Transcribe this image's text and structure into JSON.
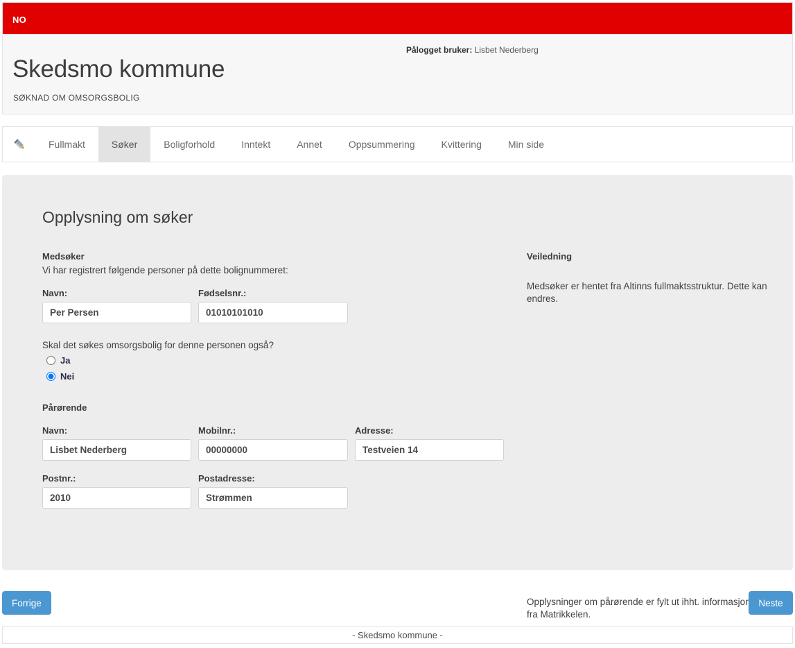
{
  "language_bar": {
    "language": "NO"
  },
  "header": {
    "logged_in_label": "Pålogget bruker:",
    "logged_in_user": "Lisbet Nederberg",
    "title": "Skedsmo kommune",
    "subtitle": "SØKNAD OM OMSORGSBOLIG"
  },
  "tabs": {
    "pencil_icon": "pencil-icon",
    "items": [
      {
        "label": "Fullmakt",
        "active": false
      },
      {
        "label": "Søker",
        "active": true
      },
      {
        "label": "Boligforhold",
        "active": false
      },
      {
        "label": "Inntekt",
        "active": false
      },
      {
        "label": "Annet",
        "active": false
      },
      {
        "label": "Oppsummering",
        "active": false
      },
      {
        "label": "Kvittering",
        "active": false
      },
      {
        "label": "Min side",
        "active": false
      }
    ]
  },
  "main": {
    "page_title": "Opplysning om søker",
    "medsoker": {
      "section_title": "Medsøker",
      "description": "Vi har registrert følgende personer på dette bolignummeret:",
      "navn_label": "Navn:",
      "navn_value": "Per Persen",
      "fodselsnr_label": "Fødselsnr.:",
      "fodselsnr_value": "01010101010",
      "question": "Skal det søkes omsorgsbolig for denne personen også?",
      "option_yes": "Ja",
      "option_no": "Nei",
      "selected": "Nei"
    },
    "parorende": {
      "section_title": "Pårørende",
      "navn_label": "Navn:",
      "navn_value": "Lisbet Nederberg",
      "mobil_label": "Mobilnr.:",
      "mobil_value": "00000000",
      "adresse_label": "Adresse:",
      "adresse_value": "Testveien 14",
      "postnr_label": "Postnr.:",
      "postnr_value": "2010",
      "postadresse_label": "Postadresse:",
      "postadresse_value": "Strømmen"
    }
  },
  "guide": {
    "title": "Veiledning",
    "text_medsoker": "Medsøker er hentet fra Altinns fullmaktsstruktur. Dette kan endres.",
    "text_parorende": "Opplysninger om pårørende er fylt ut ihht. informasjon fra Matrikkelen."
  },
  "footer": {
    "prev_button": "Forrige",
    "next_button": "Neste",
    "copyright": "- Skedsmo kommune -"
  },
  "colors": {
    "accent_red": "#e00000",
    "button_blue": "#4a97d2",
    "panel_grey": "#ededed",
    "header_grey": "#f7f7f7"
  }
}
